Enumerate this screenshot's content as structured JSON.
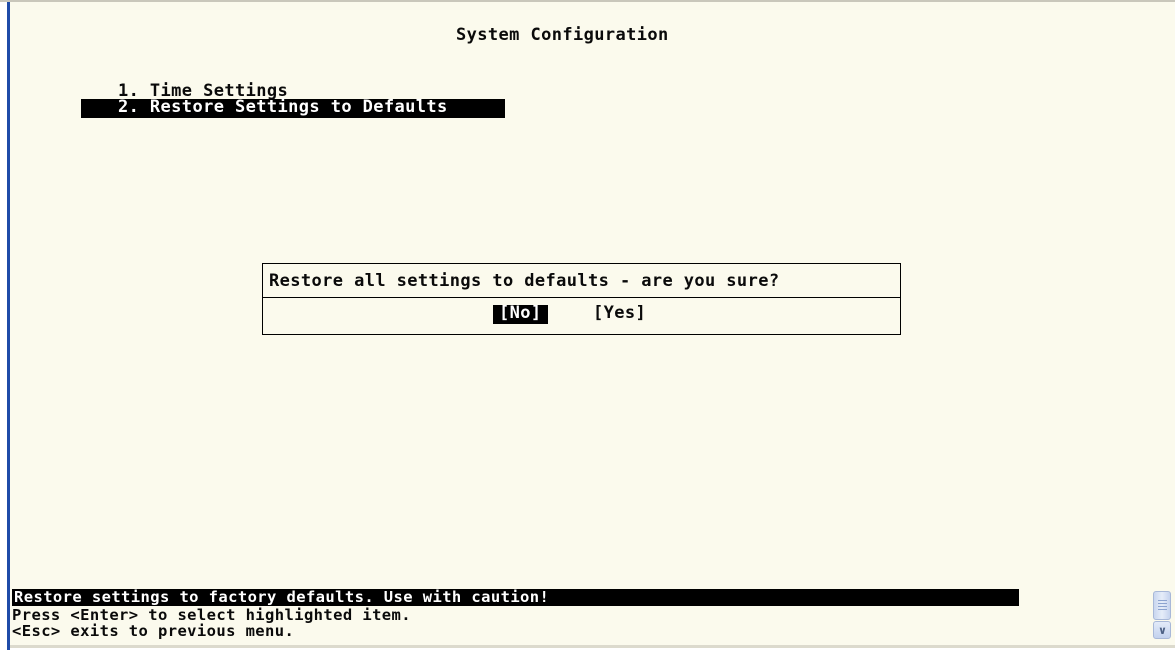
{
  "window": {
    "title": "System Configuration"
  },
  "menu": {
    "items": [
      {
        "label": "1. Time Settings",
        "highlighted": false
      },
      {
        "label": "2. Restore Settings to Defaults",
        "highlighted": true
      }
    ]
  },
  "dialog": {
    "question": "Restore all settings to defaults - are you sure?",
    "no_label": "[No]",
    "yes_label": "[Yes]",
    "selected": "[No]"
  },
  "footer": {
    "status": "Restore settings to factory defaults. Use with caution!",
    "help_enter": "Press <Enter> to select highlighted item.",
    "help_esc": "<Esc> exits to previous menu."
  },
  "icons": {
    "scroll_down": "chevron-down-icon",
    "scroll_grip": "scroll-grip-icon"
  },
  "colors": {
    "background": "#fbfaed",
    "highlight_bg": "#000000",
    "highlight_fg": "#ffffff",
    "text": "#0a0a0a",
    "accent": "#1f4ba8"
  }
}
